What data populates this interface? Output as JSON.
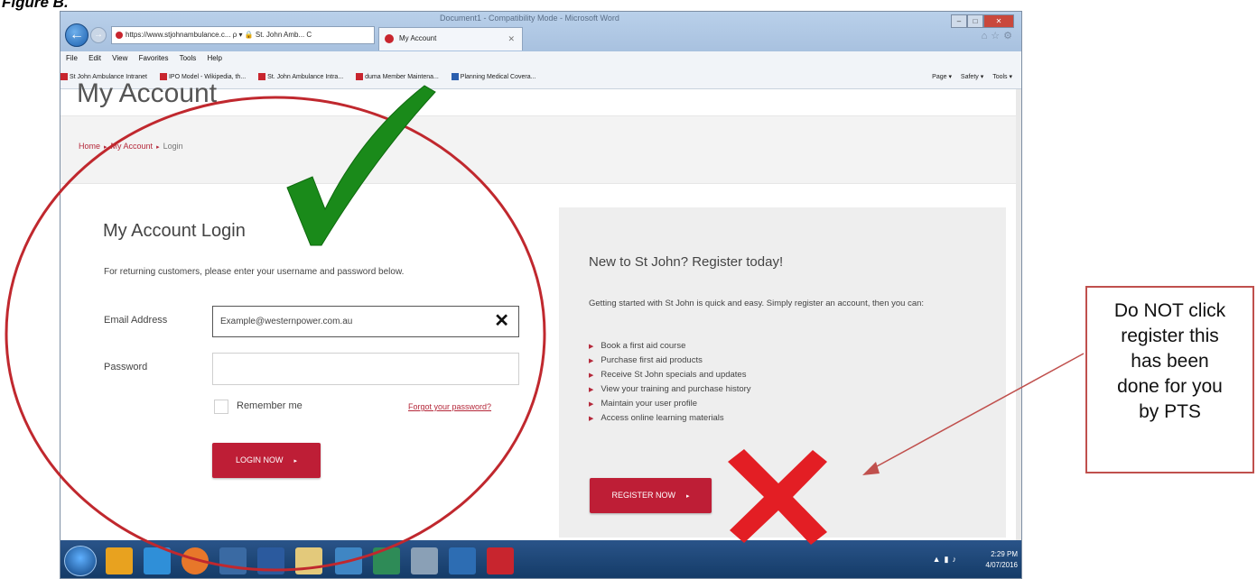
{
  "figure_label": "Figure B.",
  "browser": {
    "title": "Document1 - Compatibility Mode - Microsoft Word",
    "address": "https://www.stjohnambulance.c... ρ ▾ 🔒 St. John Amb... C",
    "tab_label": "My Account",
    "menu": [
      "File",
      "Edit",
      "View",
      "Favorites",
      "Tools",
      "Help"
    ],
    "favorites": [
      "St John Ambulance Intranet",
      "IPO Model - Wikipedia, th...",
      "St. John Ambulance Intra...",
      "duma Member Maintena...",
      "Planning Medical Covera..."
    ],
    "commands": [
      "Page ▾",
      "Safety ▾",
      "Tools ▾"
    ]
  },
  "page": {
    "title": "My Account",
    "breadcrumb": {
      "home": "Home",
      "account": "My Account",
      "current": "Login",
      "separator": "▸"
    },
    "login": {
      "heading": "My Account Login",
      "description": "For returning customers, please enter your username and password below.",
      "email_label": "Email Address",
      "email_value": "Example@westernpower.com.au",
      "clear_glyph": "✕",
      "password_label": "Password",
      "remember_label": "Remember me",
      "forgot_link": "Forgot your password?",
      "button_label": "LOGIN NOW",
      "button_arrow": "▸"
    },
    "register": {
      "heading": "New to St John? Register today!",
      "description": "Getting started with St John is quick and easy. Simply register an account, then you can:",
      "benefits": [
        "Book a first aid course",
        "Purchase first aid products",
        "Receive St John specials and updates",
        "View your training and purchase history",
        "Maintain your user profile",
        "Access online learning materials"
      ],
      "button_label": "REGISTER NOW",
      "button_arrow": "▸"
    }
  },
  "taskbar": {
    "time": "2:29 PM",
    "date": "4/07/2016"
  },
  "annotation": {
    "callout_lines": [
      "Do NOT click",
      "register  this",
      "has been",
      "done for you",
      "by PTS"
    ],
    "colors": {
      "check": "#1a8a1a",
      "cross": "#e31e24",
      "circle": "#c0282e",
      "callout_border": "#c0504d"
    }
  },
  "theme": {
    "brand_red": "#be1e36"
  }
}
